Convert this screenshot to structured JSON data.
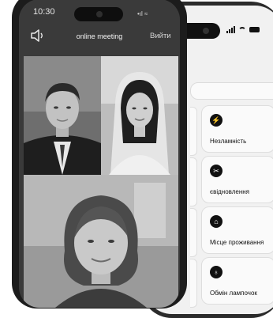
{
  "front_phone": {
    "time": "10:30",
    "status_icons": "•ıl ≈",
    "meeting_title": "online meeting",
    "exit_label": "Вийти",
    "participants": [
      {
        "id": "man-in-suit"
      },
      {
        "id": "bride"
      },
      {
        "id": "woman"
      }
    ]
  },
  "back_phone": {
    "cards": [
      {
        "label": "Незламність",
        "icon": "bolt-icon"
      },
      {
        "label": "євідновлення",
        "icon": "tools-icon"
      },
      {
        "label": "Місце проживання",
        "icon": "home-icon"
      },
      {
        "label": "Обмін лампочок",
        "icon": "bulb-icon"
      }
    ]
  }
}
